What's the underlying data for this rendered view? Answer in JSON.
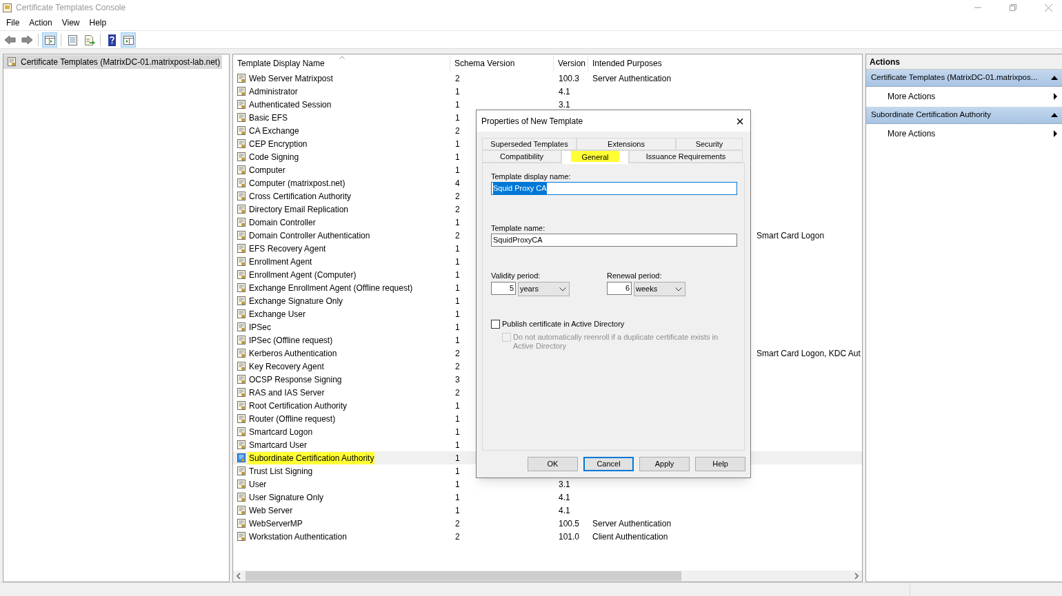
{
  "window": {
    "title": "Certificate Templates Console"
  },
  "menu": [
    "File",
    "Action",
    "View",
    "Help"
  ],
  "toolbar": [
    {
      "kind": "back",
      "pressed": false
    },
    {
      "kind": "forward",
      "pressed": false
    },
    {
      "kind": "sep"
    },
    {
      "kind": "tree",
      "pressed": true
    },
    {
      "kind": "sep"
    },
    {
      "kind": "properties",
      "pressed": false
    },
    {
      "kind": "export",
      "pressed": false
    },
    {
      "kind": "sep"
    },
    {
      "kind": "help",
      "pressed": false
    },
    {
      "kind": "pane",
      "pressed": true
    }
  ],
  "tree": {
    "items": [
      {
        "label": "Certificate Templates (MatrixDC-01.matrixpost-lab.net)",
        "selected": true
      }
    ]
  },
  "table": {
    "columns": [
      "Template Display Name",
      "Schema Version",
      "Version",
      "Intended Purposes"
    ],
    "rows": [
      {
        "name": "Web Server Matrixpost",
        "schema_version": "2",
        "version": "100.3",
        "purposes": "Server Authentication",
        "selected": false,
        "highlighted": false
      },
      {
        "name": "Administrator",
        "schema_version": "1",
        "version": "4.1",
        "selected": false,
        "highlighted": false
      },
      {
        "name": "Authenticated Session",
        "schema_version": "1",
        "version": "3.1",
        "selected": false,
        "highlighted": false
      },
      {
        "name": "Basic EFS",
        "schema_version": "1",
        "selected": false,
        "highlighted": false
      },
      {
        "name": "CA Exchange",
        "schema_version": "2",
        "selected": false,
        "highlighted": false
      },
      {
        "name": "CEP Encryption",
        "schema_version": "1",
        "selected": false,
        "highlighted": false
      },
      {
        "name": "Code Signing",
        "schema_version": "1",
        "selected": false,
        "highlighted": false
      },
      {
        "name": "Computer",
        "schema_version": "1",
        "selected": false,
        "highlighted": false
      },
      {
        "name": "Computer (matrixpost.net)",
        "schema_version": "4",
        "selected": false,
        "highlighted": false
      },
      {
        "name": "Cross Certification Authority",
        "schema_version": "2",
        "selected": false,
        "highlighted": false
      },
      {
        "name": "Directory Email Replication",
        "schema_version": "2",
        "selected": false,
        "highlighted": false
      },
      {
        "name": "Domain Controller",
        "schema_version": "1",
        "selected": false,
        "highlighted": false
      },
      {
        "name": "Domain Controller Authentication",
        "schema_version": "2",
        "purposes": "Smart Card Logon",
        "selected": false,
        "highlighted": false
      },
      {
        "name": "EFS Recovery Agent",
        "schema_version": "1",
        "selected": false,
        "highlighted": false
      },
      {
        "name": "Enrollment Agent",
        "schema_version": "1",
        "selected": false,
        "highlighted": false
      },
      {
        "name": "Enrollment Agent (Computer)",
        "schema_version": "1",
        "selected": false,
        "highlighted": false
      },
      {
        "name": "Exchange Enrollment Agent (Offline request)",
        "schema_version": "1",
        "selected": false,
        "highlighted": false
      },
      {
        "name": "Exchange Signature Only",
        "schema_version": "1",
        "selected": false,
        "highlighted": false
      },
      {
        "name": "Exchange User",
        "schema_version": "1",
        "selected": false,
        "highlighted": false
      },
      {
        "name": "IPSec",
        "schema_version": "1",
        "selected": false,
        "highlighted": false
      },
      {
        "name": "IPSec (Offline request)",
        "schema_version": "1",
        "selected": false,
        "highlighted": false
      },
      {
        "name": "Kerberos Authentication",
        "schema_version": "2",
        "purposes": "Smart Card Logon, KDC Aut",
        "selected": false,
        "highlighted": false
      },
      {
        "name": "Key Recovery Agent",
        "schema_version": "2",
        "selected": false,
        "highlighted": false
      },
      {
        "name": "OCSP Response Signing",
        "schema_version": "3",
        "selected": false,
        "highlighted": false
      },
      {
        "name": "RAS and IAS Server",
        "schema_version": "2",
        "selected": false,
        "highlighted": false
      },
      {
        "name": "Root Certification Authority",
        "schema_version": "1",
        "selected": false,
        "highlighted": false
      },
      {
        "name": "Router (Offline request)",
        "schema_version": "1",
        "selected": false,
        "highlighted": false
      },
      {
        "name": "Smartcard Logon",
        "schema_version": "1",
        "selected": false,
        "highlighted": false
      },
      {
        "name": "Smartcard User",
        "schema_version": "1",
        "selected": false,
        "highlighted": false
      },
      {
        "name": "Subordinate Certification Authority",
        "schema_version": "1",
        "selected": true,
        "highlighted": true
      },
      {
        "name": "Trust List Signing",
        "schema_version": "1",
        "selected": false,
        "highlighted": false
      },
      {
        "name": "User",
        "schema_version": "1",
        "version": "3.1",
        "selected": false,
        "highlighted": false
      },
      {
        "name": "User Signature Only",
        "schema_version": "1",
        "version": "4.1",
        "selected": false,
        "highlighted": false
      },
      {
        "name": "Web Server",
        "schema_version": "1",
        "version": "4.1",
        "selected": false,
        "highlighted": false
      },
      {
        "name": "WebServerMP",
        "schema_version": "2",
        "version": "100.5",
        "purposes": "Server Authentication",
        "selected": false,
        "highlighted": false
      },
      {
        "name": "Workstation Authentication",
        "schema_version": "2",
        "version": "101.0",
        "purposes": "Client Authentication",
        "selected": false,
        "highlighted": false
      }
    ]
  },
  "actions": {
    "title": "Actions",
    "sections": [
      {
        "title": "Certificate Templates (MatrixDC-01.matrixpos...",
        "expanded": true,
        "items": [
          "More Actions"
        ]
      },
      {
        "title": "Subordinate Certification Authority",
        "expanded": true,
        "items": [
          "More Actions"
        ]
      }
    ]
  },
  "dialog": {
    "title": "Properties of New Template",
    "close": "×",
    "tab_rows": [
      [
        {
          "label": "Superseded Templates",
          "selected": false,
          "highlighted": false
        },
        {
          "label": "Extensions",
          "selected": false,
          "highlighted": false
        },
        {
          "label": "Security",
          "selected": false,
          "highlighted": false
        }
      ],
      [
        {
          "label": "Compatibility",
          "selected": false,
          "highlighted": false
        },
        {
          "label": "General",
          "selected": true,
          "highlighted": true
        },
        {
          "label": "Issuance Requirements",
          "selected": false,
          "highlighted": false
        }
      ]
    ],
    "display_name": {
      "label": "Template display name:",
      "value": "Squid Proxy CA",
      "text_selected": true
    },
    "template_name": {
      "label": "Template name:",
      "value": "SquidProxyCA",
      "text_selected": false
    },
    "validity": {
      "label": "Validity period:",
      "number": "5",
      "unit": "years"
    },
    "renewal": {
      "label": "Renewal period:",
      "number": "6",
      "unit": "weeks"
    },
    "checkboxes": [
      {
        "label": "Publish certificate in Active Directory",
        "checked": false,
        "disabled": false
      },
      {
        "label": "Do not automatically reenroll if a duplicate certificate exists in Active Directory",
        "checked": false,
        "disabled": true
      }
    ],
    "buttons": [
      {
        "label": "OK",
        "default": false
      },
      {
        "label": "Cancel",
        "default": true
      },
      {
        "label": "Apply",
        "default": false
      },
      {
        "label": "Help",
        "default": false
      }
    ]
  }
}
